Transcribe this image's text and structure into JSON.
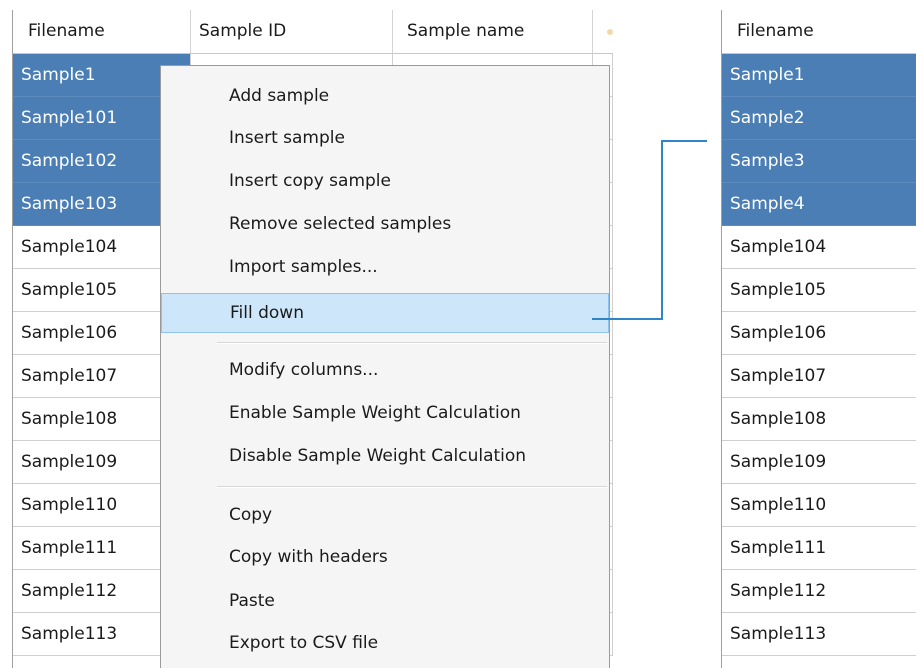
{
  "left_grid": {
    "columns": [
      "Filename",
      "Sample ID",
      "Sample name"
    ],
    "rows": [
      {
        "filename": "Sample1",
        "selected": true
      },
      {
        "filename": "Sample101",
        "selected": true
      },
      {
        "filename": "Sample102",
        "selected": true
      },
      {
        "filename": "Sample103",
        "selected": true
      },
      {
        "filename": "Sample104",
        "selected": false
      },
      {
        "filename": "Sample105",
        "selected": false
      },
      {
        "filename": "Sample106",
        "selected": false
      },
      {
        "filename": "Sample107",
        "selected": false
      },
      {
        "filename": "Sample108",
        "selected": false
      },
      {
        "filename": "Sample109",
        "selected": false
      },
      {
        "filename": "Sample110",
        "selected": false
      },
      {
        "filename": "Sample111",
        "selected": false
      },
      {
        "filename": "Sample112",
        "selected": false
      },
      {
        "filename": "Sample113",
        "selected": false
      }
    ]
  },
  "context_menu": {
    "items": [
      {
        "label": "Add sample"
      },
      {
        "label": "Insert sample"
      },
      {
        "label": "Insert copy sample"
      },
      {
        "label": "Remove selected samples"
      },
      {
        "label": "Import samples..."
      },
      {
        "label": "Fill down",
        "highlighted": true
      },
      {
        "label": "Modify columns..."
      },
      {
        "label": "Enable Sample Weight Calculation"
      },
      {
        "label": "Disable Sample Weight Calculation"
      },
      {
        "label": "Copy"
      },
      {
        "label": "Copy with headers"
      },
      {
        "label": "Paste"
      },
      {
        "label": "Export to CSV file"
      }
    ]
  },
  "right_grid": {
    "columns": [
      "Filename"
    ],
    "rows": [
      {
        "filename": "Sample1",
        "selected": true
      },
      {
        "filename": "Sample2",
        "selected": true
      },
      {
        "filename": "Sample3",
        "selected": true
      },
      {
        "filename": "Sample4",
        "selected": true
      },
      {
        "filename": "Sample104",
        "selected": false
      },
      {
        "filename": "Sample105",
        "selected": false
      },
      {
        "filename": "Sample106",
        "selected": false
      },
      {
        "filename": "Sample107",
        "selected": false
      },
      {
        "filename": "Sample108",
        "selected": false
      },
      {
        "filename": "Sample109",
        "selected": false
      },
      {
        "filename": "Sample110",
        "selected": false
      },
      {
        "filename": "Sample111",
        "selected": false
      },
      {
        "filename": "Sample112",
        "selected": false
      },
      {
        "filename": "Sample113",
        "selected": false
      }
    ]
  },
  "colors": {
    "selection": "#4a7eb5",
    "menu_highlight": "#cde6fa",
    "connector": "#2e86c9"
  }
}
